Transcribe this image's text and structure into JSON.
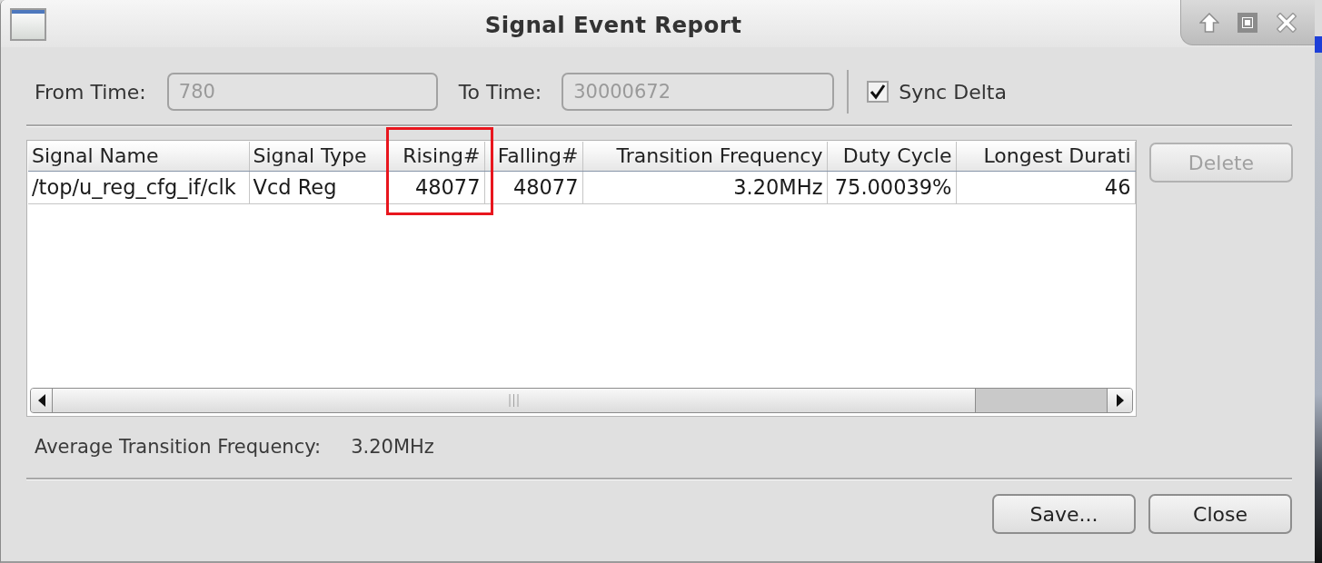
{
  "window": {
    "title": "Signal Event Report"
  },
  "time_range": {
    "from": {
      "label": "From Time:",
      "value": "780",
      "disabled": true
    },
    "to": {
      "label": "To Time:",
      "value": "30000672",
      "disabled": true
    },
    "sync_delta": {
      "label": "Sync Delta",
      "checked": true
    }
  },
  "table": {
    "columns": [
      {
        "label": "Signal Name",
        "highlighted": false
      },
      {
        "label": "Signal Type",
        "highlighted": false
      },
      {
        "label": "Rising#",
        "highlighted": true
      },
      {
        "label": "Falling#",
        "highlighted": false
      },
      {
        "label": "Transition Frequency",
        "highlighted": false
      },
      {
        "label": "Duty Cycle",
        "highlighted": false
      },
      {
        "label": "Longest Durati",
        "highlighted": false
      }
    ],
    "rows": [
      {
        "cells": [
          "/top/u_reg_cfg_if/clk",
          "Vcd Reg",
          "48077",
          "48077",
          "3.20MHz",
          "75.00039%",
          "46"
        ]
      }
    ]
  },
  "delete_button": {
    "label": "Delete",
    "disabled": true
  },
  "summary": {
    "label": "Average Transition Frequency:",
    "value": "3.20MHz"
  },
  "buttons": [
    {
      "label": "Save..."
    },
    {
      "label": "Close"
    }
  ]
}
